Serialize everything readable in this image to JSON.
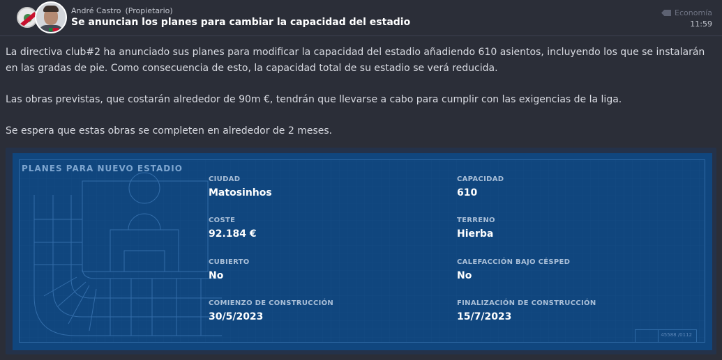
{
  "header": {
    "owner_name": "André Castro",
    "owner_role": "(Propietario)",
    "title": "Se anuncian los planes para cambiar la capacidad del estadio",
    "category": "Economía",
    "time": "11:59"
  },
  "body": {
    "paragraphs": [
      "La directiva club#2 ha anunciado sus planes para modificar la capacidad del estadio añadiendo 610 asientos, incluyendo los que se instalarán en las gradas de pie. Como consecuencia de esto, la capacidad total de su estadio se verá reducida.",
      "Las obras previstas, que costarán alrededor de 90m €, tendrán que llevarse a cabo para cumplir con las exigencias de la liga.",
      "Se espera que estas obras se completen en alrededor de 2 meses."
    ]
  },
  "plans": {
    "title": "PLANES PARA NUEVO ESTADIO",
    "fields": [
      {
        "label": "CIUDAD",
        "value": "Matosinhos"
      },
      {
        "label": "CAPACIDAD",
        "value": "610"
      },
      {
        "label": "COSTE",
        "value": "92.184 €"
      },
      {
        "label": "TERRENO",
        "value": "Hierba"
      },
      {
        "label": "CUBIERTO",
        "value": "No"
      },
      {
        "label": "CALEFACCIÓN BAJO CÉSPED",
        "value": "No"
      },
      {
        "label": "COMIENZO DE CONSTRUCCIÓN",
        "value": "30/5/2023"
      },
      {
        "label": "FINALIZACIÓN DE CONSTRUCCIÓN",
        "value": "15/7/2023"
      }
    ],
    "ref_code": "45588 /0112"
  },
  "icons": {
    "club_badge": "club-crest-icon",
    "avatar": "owner-avatar",
    "category": "tag-icon"
  },
  "colors": {
    "background": "#2b2e38",
    "blueprint": "#10467e",
    "title_text": "#ffffff",
    "label_text": "#a9bfd8"
  }
}
